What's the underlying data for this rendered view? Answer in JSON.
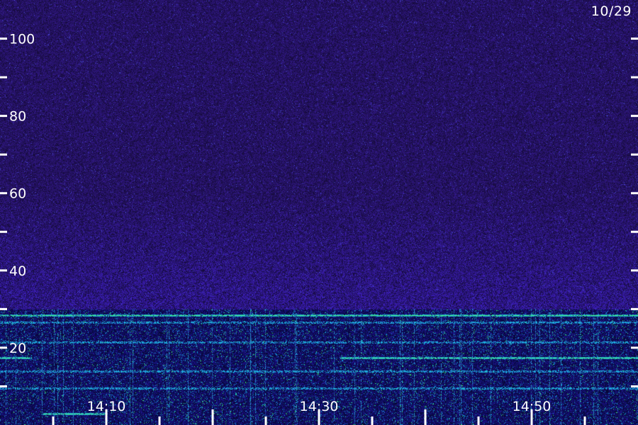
{
  "date_label": "10/29",
  "colors": {
    "background": "#2a1262",
    "noise_low": "#1c0c55",
    "noise_mid": "#3a1fa8",
    "noise_high": "#4b3bd8",
    "signal_cyan": "#29b6e8",
    "signal_green": "#3bea7a",
    "axis": "#ffffff"
  },
  "chart_data": {
    "type": "heatmap",
    "title": "",
    "xlabel": "",
    "ylabel": "",
    "y_axis": {
      "range": [
        0,
        110
      ],
      "labeled_ticks": [
        100,
        80,
        60,
        40,
        20
      ],
      "tick_labels": [
        "100",
        "80",
        "60",
        "40",
        "20"
      ],
      "minor_ticks": [
        10,
        30,
        50,
        70,
        90
      ]
    },
    "x_axis": {
      "range_minutes": [
        0,
        60
      ],
      "start_time": "14:00",
      "labeled_ticks": [
        "14:10",
        "14:30",
        "14:50"
      ],
      "tick_minutes": [
        5,
        10,
        15,
        20,
        25,
        30,
        35,
        40,
        45,
        50,
        55
      ]
    },
    "bands": [
      {
        "y": 28.5,
        "intensity": "strong",
        "extent_minutes": [
          0,
          60
        ]
      },
      {
        "y": 26.5,
        "intensity": "medium",
        "extent_minutes": [
          0,
          60
        ]
      },
      {
        "y": 21.5,
        "intensity": "medium",
        "extent_minutes": [
          0,
          60
        ]
      },
      {
        "y": 17.5,
        "intensity": "strong",
        "extent_minutes": [
          32,
          60
        ]
      },
      {
        "y": 17.5,
        "intensity": "strong",
        "extent_minutes": [
          0,
          3
        ]
      },
      {
        "y": 14.0,
        "intensity": "medium",
        "extent_minutes": [
          0,
          60
        ]
      },
      {
        "y": 9.5,
        "intensity": "medium",
        "extent_minutes": [
          0,
          60
        ]
      },
      {
        "y": 3.0,
        "intensity": "strong",
        "extent_minutes": [
          4,
          10
        ]
      }
    ]
  }
}
